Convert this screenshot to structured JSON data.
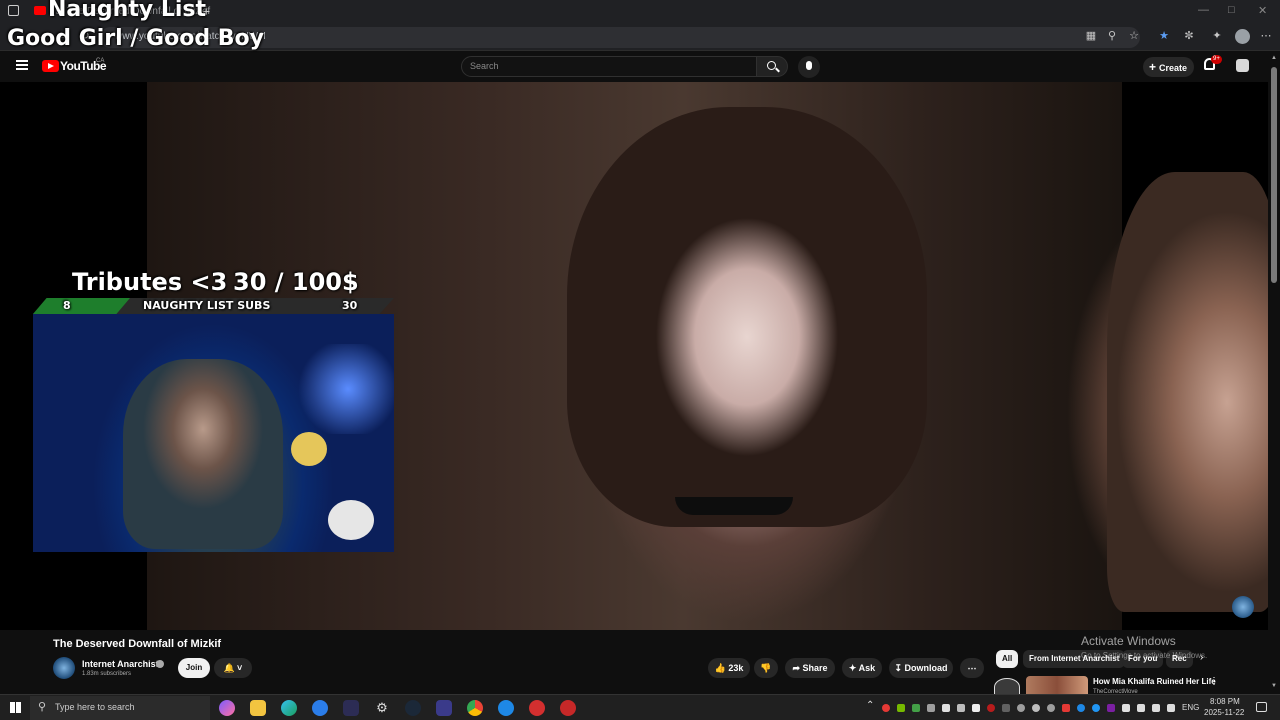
{
  "browser": {
    "tab_title": "(9) The Deserved Downfall of Mizkif",
    "new_tab": "+",
    "url": "www.youtube.com/watch?v=NWJI"
  },
  "overlay": {
    "naughty_list": "Naughty List",
    "good_girl_boy": "Good Girl / Good Boy",
    "tributes_label": "Tributes <3",
    "tributes_value": "30 / 100$",
    "subs_left": "8",
    "subs_label": "NAUGHTY LIST SUBS",
    "subs_right": "30",
    "subs_progress": 0.27
  },
  "youtube": {
    "logo_text": "YouTube",
    "logo_region": "CA",
    "search_placeholder": "Search",
    "create_label": "Create",
    "notification_count": "9+"
  },
  "video": {
    "title": "The Deserved Downfall of Mizkif",
    "channel_name": "Internet Anarchist",
    "subscribers": "1.83m subscribers",
    "join_label": "Join",
    "likes": "23k",
    "share_label": "Share",
    "ask_label": "Ask",
    "download_label": "Download"
  },
  "chips": [
    "All",
    "From Internet Anarchist",
    "For you",
    "Rec"
  ],
  "recommended": {
    "title": "How Mia Khalifa Ruined Her Life",
    "channel": "TheCorrectMove"
  },
  "watermark": {
    "line1": "Activate Windows",
    "line2": "Go to Settings to activate Windows."
  },
  "taskbar": {
    "search_placeholder": "Type here to search",
    "language": "ENG",
    "time": "8:08 PM",
    "date": "2025-11-22"
  },
  "colors": {
    "youtube_red": "#ff0000",
    "progress_green": "#1e7e2c",
    "background": "#0f0f0f"
  }
}
